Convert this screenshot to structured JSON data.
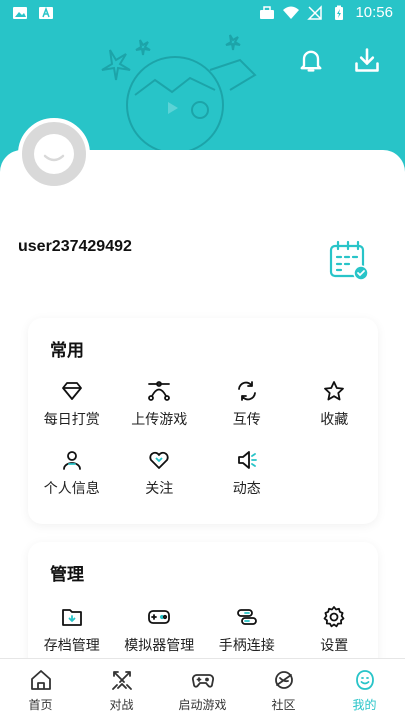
{
  "status_bar": {
    "time": "10:56"
  },
  "profile": {
    "username": "user237429492"
  },
  "sections": {
    "common": {
      "title": "常用",
      "items": [
        {
          "label": "每日打赏",
          "icon": "diamond-icon"
        },
        {
          "label": "上传游戏",
          "icon": "bezier-icon"
        },
        {
          "label": "互传",
          "icon": "sync-icon"
        },
        {
          "label": "收藏",
          "icon": "star-icon"
        },
        {
          "label": "个人信息",
          "icon": "person-icon"
        },
        {
          "label": "关注",
          "icon": "heart-icon"
        },
        {
          "label": "动态",
          "icon": "speaker-icon"
        }
      ]
    },
    "manage": {
      "title": "管理",
      "items": [
        {
          "label": "存档管理",
          "icon": "folder-icon"
        },
        {
          "label": "模拟器管理",
          "icon": "gamepad-icon"
        },
        {
          "label": "手柄连接",
          "icon": "link-icon"
        },
        {
          "label": "设置",
          "icon": "gear-icon"
        }
      ]
    }
  },
  "tabbar": {
    "tabs": [
      {
        "label": "首页",
        "icon": "home-icon"
      },
      {
        "label": "对战",
        "icon": "swords-icon"
      },
      {
        "label": "启动游戏",
        "icon": "controller-icon"
      },
      {
        "label": "社区",
        "icon": "planet-icon"
      },
      {
        "label": "我的",
        "icon": "smile-face-icon"
      }
    ],
    "active_index": 4
  },
  "colors": {
    "accent": "#28c4c8",
    "text": "#111111"
  }
}
